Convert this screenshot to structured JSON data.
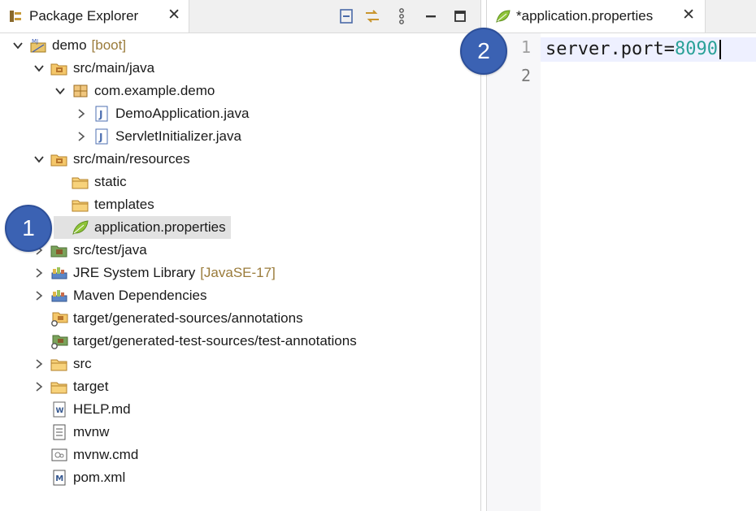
{
  "left": {
    "tab_title": "Package Explorer",
    "tree": [
      {
        "label": "demo",
        "decor": "[boot]",
        "icon": "project-icon",
        "expanded": true
      },
      {
        "label": "src/main/java",
        "icon": "source-folder-icon",
        "expanded": true
      },
      {
        "label": "com.example.demo",
        "icon": "package-icon",
        "expanded": true
      },
      {
        "label": "DemoApplication.java",
        "icon": "java-file-icon",
        "expanded": false
      },
      {
        "label": "ServletInitializer.java",
        "icon": "java-file-icon",
        "expanded": false
      },
      {
        "label": "src/main/resources",
        "icon": "source-folder-icon",
        "expanded": true
      },
      {
        "label": "static",
        "icon": "folder-icon"
      },
      {
        "label": "templates",
        "icon": "folder-icon"
      },
      {
        "label": "application.properties",
        "icon": "spring-properties-icon",
        "selected": true
      },
      {
        "label": "src/test/java",
        "icon": "test-source-folder-icon",
        "expanded": false
      },
      {
        "label": "JRE System Library",
        "decor": "[JavaSE-17]",
        "icon": "library-icon",
        "expanded": false
      },
      {
        "label": "Maven Dependencies",
        "icon": "library-icon",
        "expanded": false
      },
      {
        "label": "target/generated-sources/annotations",
        "icon": "generated-source-folder-icon"
      },
      {
        "label": "target/generated-test-sources/test-annotations",
        "icon": "generated-test-folder-icon"
      },
      {
        "label": "src",
        "icon": "folder-icon",
        "expanded": false
      },
      {
        "label": "target",
        "icon": "folder-icon",
        "expanded": false
      },
      {
        "label": "HELP.md",
        "icon": "markdown-file-icon"
      },
      {
        "label": "mvnw",
        "icon": "text-file-icon"
      },
      {
        "label": "mvnw.cmd",
        "icon": "cmd-file-icon"
      },
      {
        "label": "pom.xml",
        "icon": "maven-pom-icon"
      }
    ]
  },
  "right": {
    "tab_title": "*application.properties",
    "lines": [
      {
        "number": "1",
        "key": "server.port=",
        "value": "8090"
      },
      {
        "number": "2",
        "key": "",
        "value": ""
      }
    ]
  },
  "badges": {
    "one": "1",
    "two": "2"
  },
  "colors": {
    "badge": "#3b62b3",
    "value": "#2aa198",
    "selection": "#e2e2e2"
  }
}
